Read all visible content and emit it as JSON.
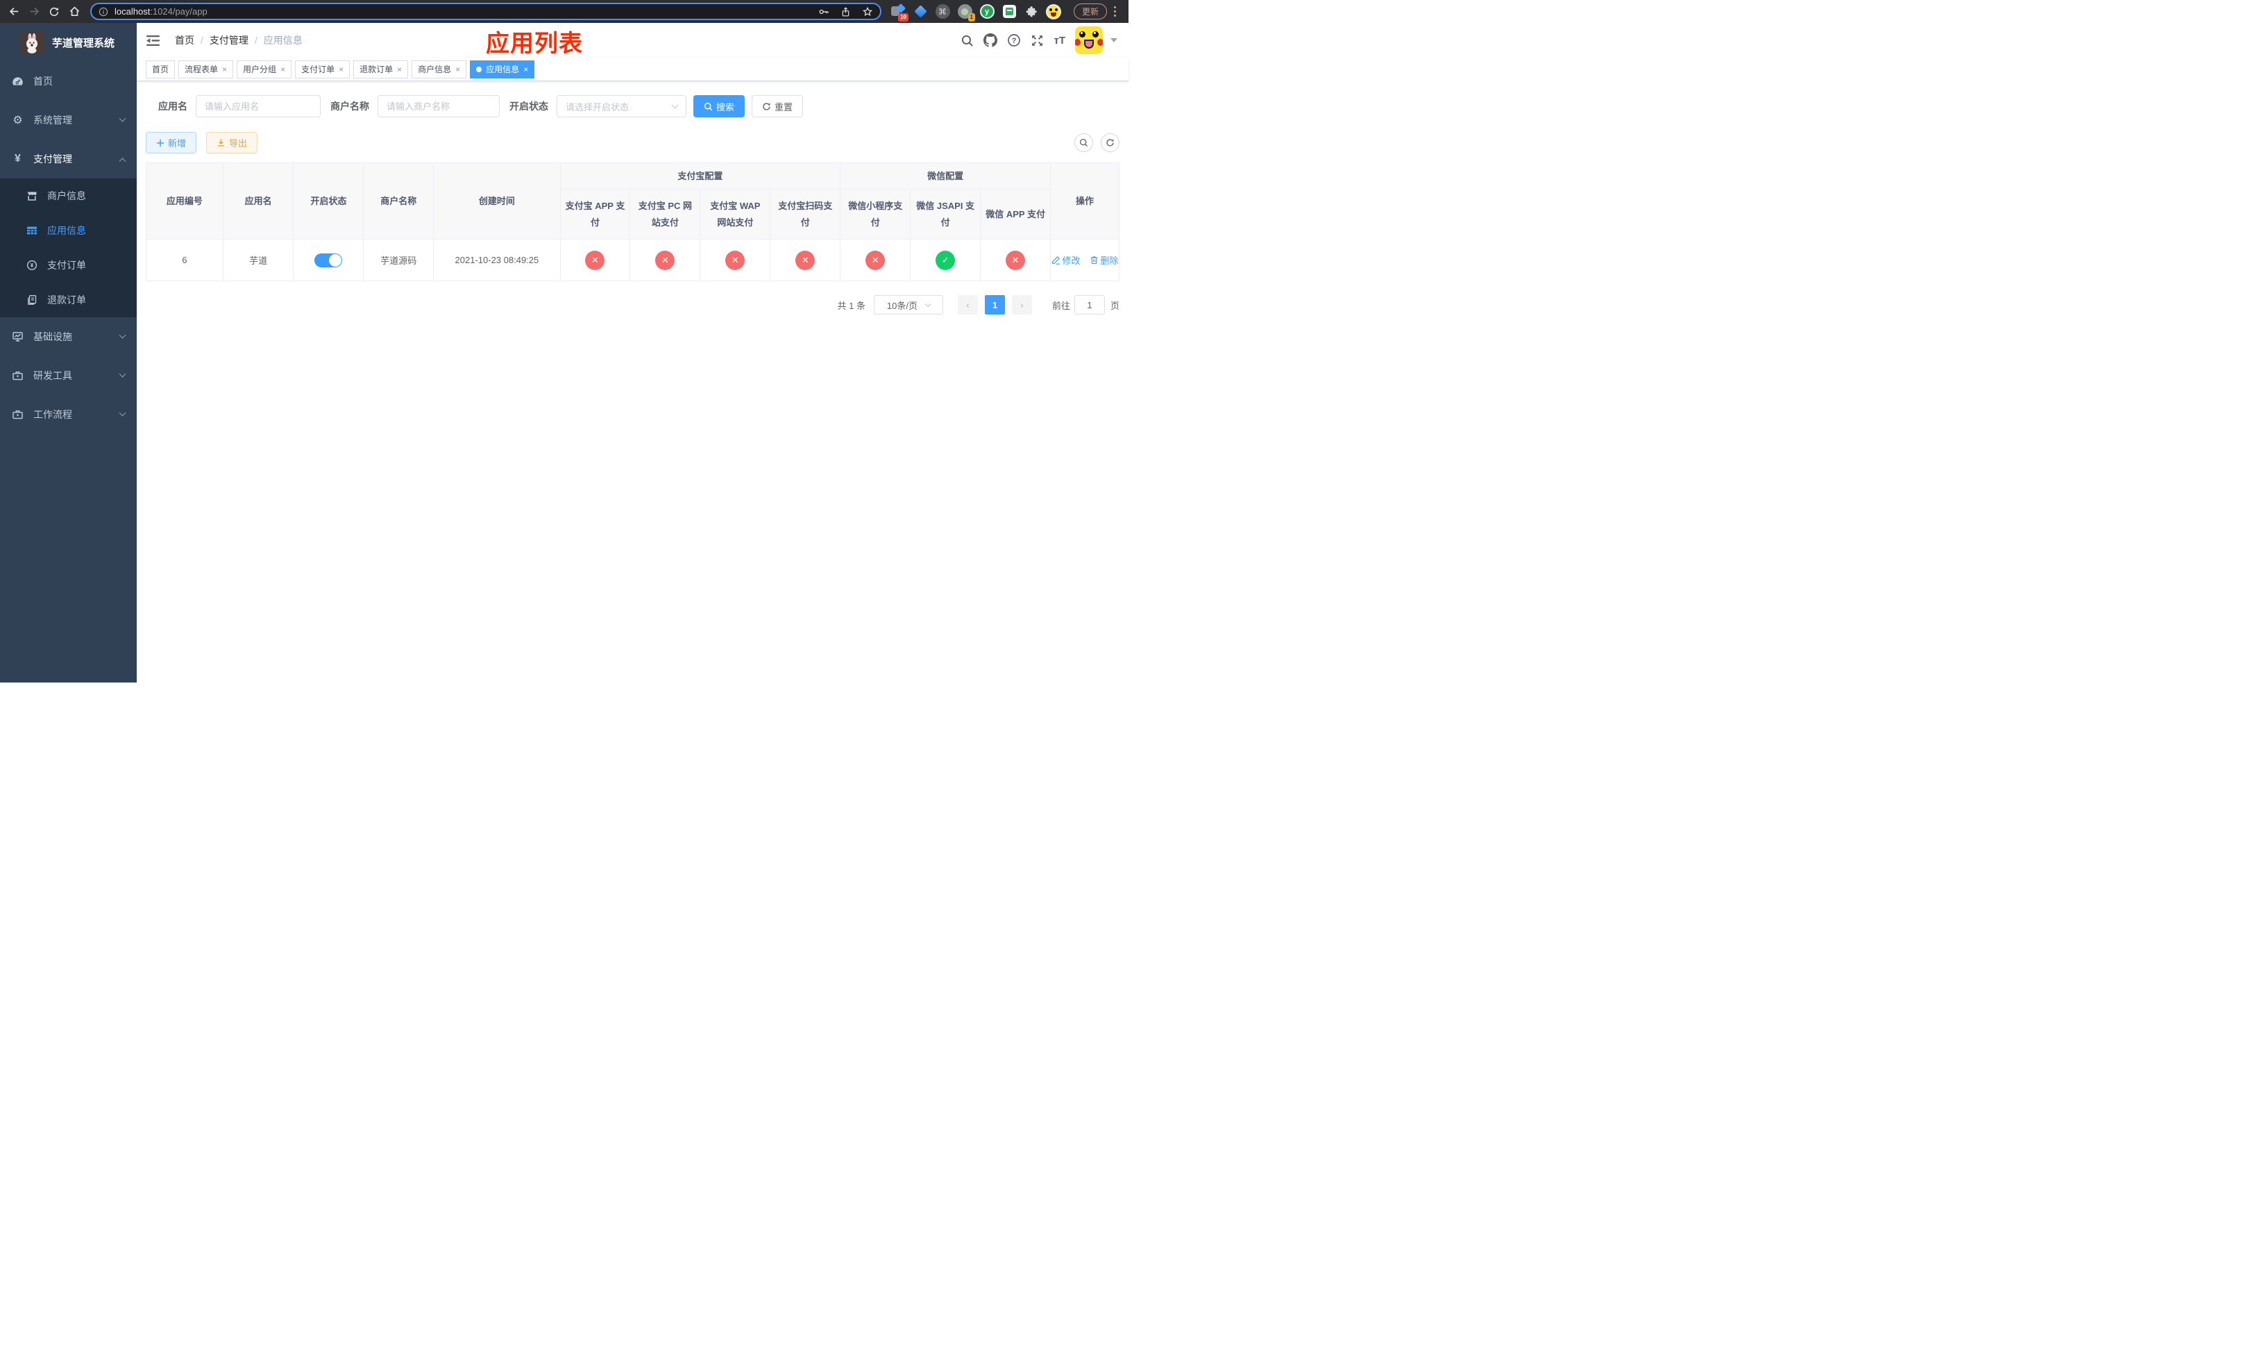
{
  "colors": {
    "primary": "#409EFF",
    "danger": "#F56C6C",
    "success": "#13CE66",
    "warning": "#E6A23C",
    "annotation_red": "#FE2B00",
    "sidebar_bg": "#304156",
    "submenu_bg": "#1F2D3D"
  },
  "browser": {
    "url": {
      "host": "localhost",
      "rest": ":1024/pay/app"
    },
    "update_label": "更新",
    "ext1_badge": "10",
    "ext4_badge": "1",
    "ext5_letter": "y",
    "cmd_glyph": "⌘"
  },
  "sidebar": {
    "app_title": "芋道管理系统",
    "menu": [
      {
        "label": "首页"
      },
      {
        "label": "系统管理"
      },
      {
        "label": "支付管理"
      },
      {
        "label": "基础设施"
      },
      {
        "label": "研发工具"
      },
      {
        "label": "工作流程"
      }
    ],
    "submenu": [
      {
        "label": "商户信息"
      },
      {
        "label": "应用信息"
      },
      {
        "label": "支付订单"
      },
      {
        "label": "退款订单"
      }
    ],
    "yen_glyph": "¥",
    "gear_glyph": "⚙"
  },
  "navbar": {
    "breadcrumb": [
      "首页",
      "支付管理",
      "应用信息"
    ],
    "separator": "/",
    "annotation": "应用列表",
    "font_size_glyph": "тT"
  },
  "tabs": [
    {
      "label": "首页"
    },
    {
      "label": "流程表单",
      "close": "×"
    },
    {
      "label": "用户分组",
      "close": "×"
    },
    {
      "label": "支付订单",
      "close": "×"
    },
    {
      "label": "退款订单",
      "close": "×"
    },
    {
      "label": "商户信息",
      "close": "×"
    },
    {
      "label": "应用信息",
      "close": "×"
    }
  ],
  "filters": {
    "app_name": {
      "label": "应用名",
      "placeholder": "请输入应用名",
      "value": ""
    },
    "merchant_name": {
      "label": "商户名称",
      "placeholder": "请输入商户名称",
      "value": ""
    },
    "status": {
      "label": "开启状态",
      "placeholder": "请选择开启状态"
    },
    "search_label": "搜索",
    "reset_label": "重置"
  },
  "toolbar": {
    "add_label": "新增",
    "export_label": "导出"
  },
  "table": {
    "headers": {
      "app_id": "应用编号",
      "app_name": "应用名",
      "status": "开启状态",
      "merchant": "商户名称",
      "created": "创建时间",
      "alipay_group": "支付宝配置",
      "wechat_group": "微信配置",
      "actions": "操作",
      "alipay_cols": [
        "支付宝 APP 支付",
        "支付宝 PC 网站支付",
        "支付宝 WAP 网站支付",
        "支付宝扫码支付"
      ],
      "wechat_cols": [
        "微信小程序支付",
        "微信 JSAPI 支付",
        "微信 APP 支付"
      ]
    },
    "row": {
      "app_id": "6",
      "app_name": "芋道",
      "merchant": "芋道源码",
      "created": "2021-10-23 08:49:25",
      "configs": [
        {
          "glyph": "✕",
          "cls": "cfg-badge badge-danger"
        },
        {
          "glyph": "✕",
          "cls": "cfg-badge badge-danger"
        },
        {
          "glyph": "✕",
          "cls": "cfg-badge badge-danger"
        },
        {
          "glyph": "✕",
          "cls": "cfg-badge badge-danger"
        },
        {
          "glyph": "✕",
          "cls": "cfg-badge badge-danger"
        },
        {
          "glyph": "✓",
          "cls": "cfg-badge badge-success"
        },
        {
          "glyph": "✕",
          "cls": "cfg-badge badge-danger"
        }
      ],
      "edit_label": "修改",
      "delete_label": "删除"
    }
  },
  "pagination": {
    "total": "共 1 条",
    "page_size": "10条/页",
    "prev": "‹",
    "current": "1",
    "next": "›",
    "goto_label": "前往",
    "goto_value": "1",
    "page_label": "页"
  }
}
